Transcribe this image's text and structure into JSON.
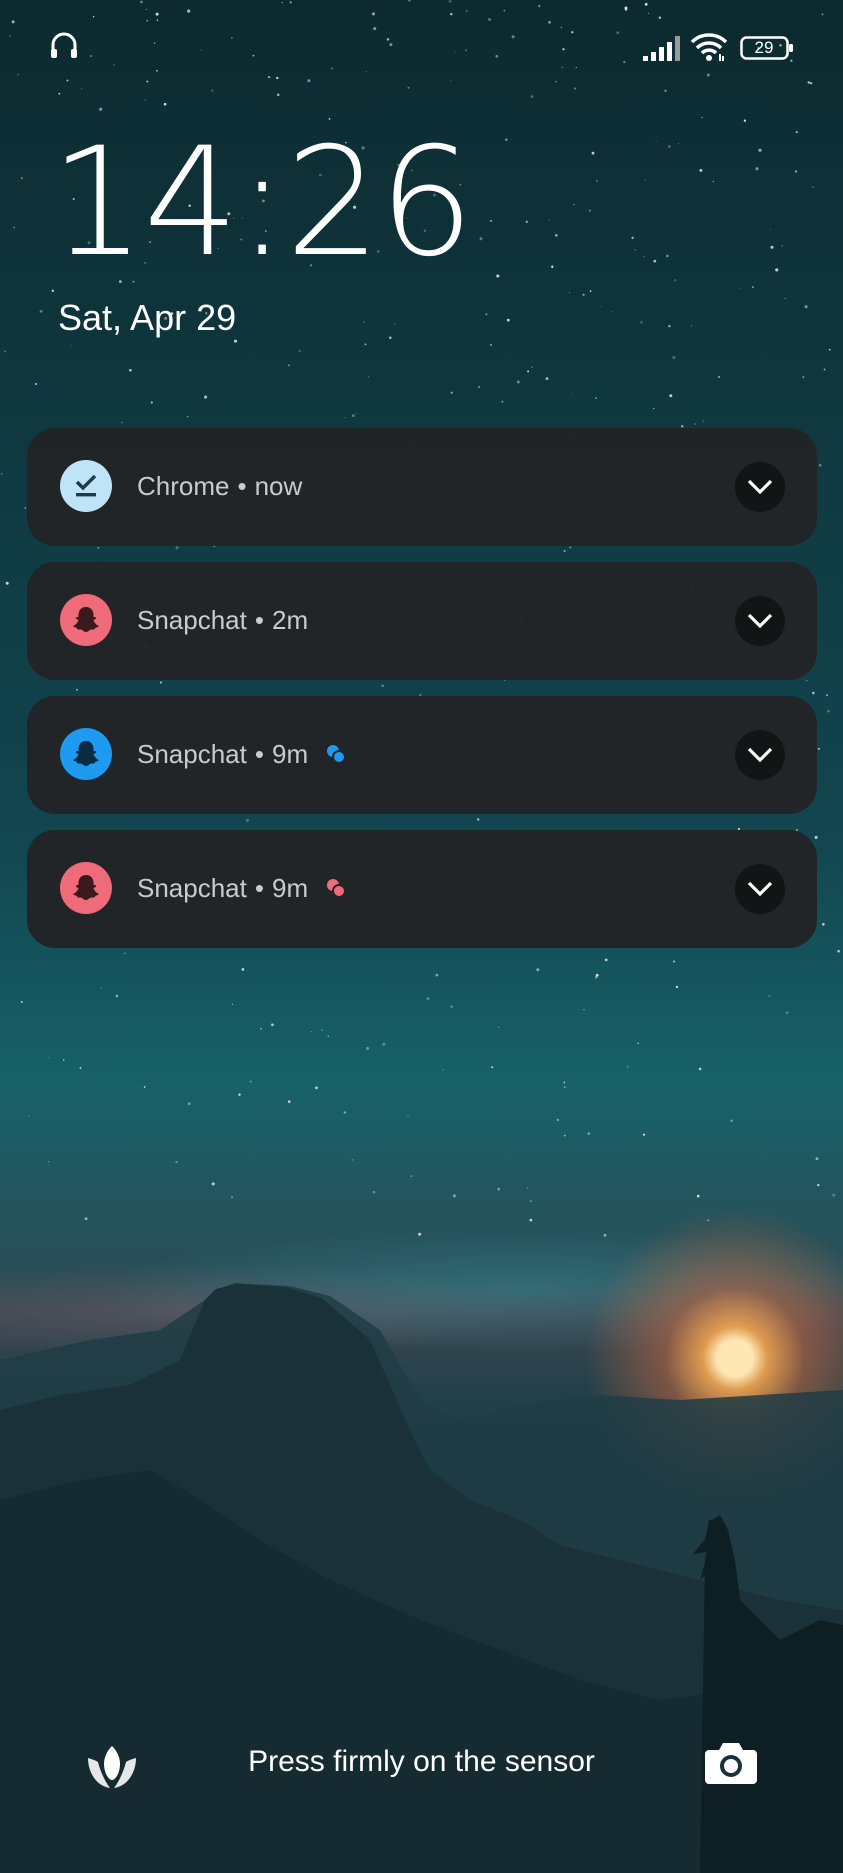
{
  "status_bar": {
    "left_icon": "headphones-icon",
    "right_icons": [
      "signal-icon",
      "wifi-icon",
      "battery-icon"
    ],
    "battery_level": "29"
  },
  "lockscreen": {
    "time": "14:26",
    "date": "Sat, Apr 29"
  },
  "notifications": [
    {
      "app": "Chrome",
      "time": "now",
      "icon": "download-done-icon",
      "icon_bg": "#bfe3f7",
      "icon_fg": "#1b3a4a",
      "badge": null
    },
    {
      "app": "Snapchat",
      "time": "2m",
      "icon": "snapchat-ghost-icon",
      "icon_bg": "#ef6b7a",
      "icon_fg": "#3a1a1f",
      "badge": null
    },
    {
      "app": "Snapchat",
      "time": "9m",
      "icon": "snapchat-ghost-icon",
      "icon_bg": "#1e9af0",
      "icon_fg": "#0b2a44",
      "badge": "chat-bubble-icon",
      "badge_color": "#1e9af0"
    },
    {
      "app": "Snapchat",
      "time": "9m",
      "icon": "snapchat-ghost-icon",
      "icon_bg": "#ef6b7a",
      "icon_fg": "#3a1a1f",
      "badge": "chat-bubble-icon",
      "badge_color": "#ef6b7a"
    }
  ],
  "separator": "•",
  "bottom": {
    "left_icon": "flower-icon",
    "hint": "Press firmly on the sensor",
    "right_icon": "camera-icon"
  }
}
